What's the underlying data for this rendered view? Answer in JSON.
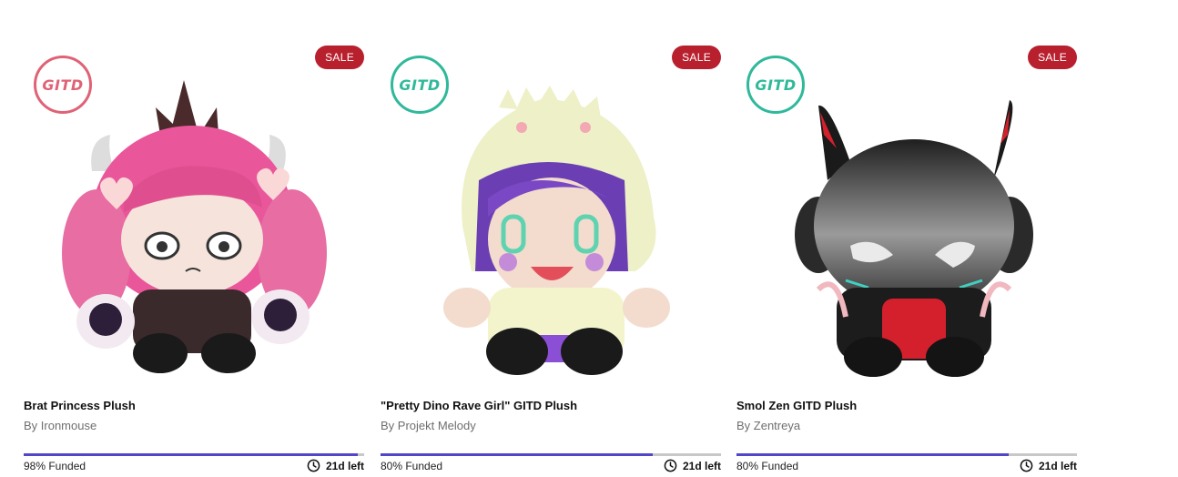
{
  "products": [
    {
      "sale_label": "SALE",
      "gitd_label": "GITD",
      "gitd_color": "#e06277",
      "image_icon": "brat-princess-plush-image",
      "title": "Brat Princess Plush",
      "creator": "By Ironmouse",
      "funded_pct": 98,
      "funded_label": "98% Funded",
      "time_left": "21d left"
    },
    {
      "sale_label": "SALE",
      "gitd_label": "GITD",
      "gitd_color": "#2fb99a",
      "image_icon": "pretty-dino-rave-girl-plush-image",
      "title": "\"Pretty Dino Rave Girl\" GITD Plush",
      "creator": "By Projekt Melody",
      "funded_pct": 80,
      "funded_label": "80% Funded",
      "time_left": "21d left"
    },
    {
      "sale_label": "SALE",
      "gitd_label": "GITD",
      "gitd_color": "#2fb99a",
      "image_icon": "smol-zen-gitd-plush-image",
      "title": "Smol Zen GITD Plush",
      "creator": "By Zentreya",
      "funded_pct": 80,
      "funded_label": "80% Funded",
      "time_left": "21d left"
    }
  ],
  "colors": {
    "sale": "#b8202e",
    "progress_fill": "#5046c8",
    "progress_track": "#c8c8c8"
  }
}
